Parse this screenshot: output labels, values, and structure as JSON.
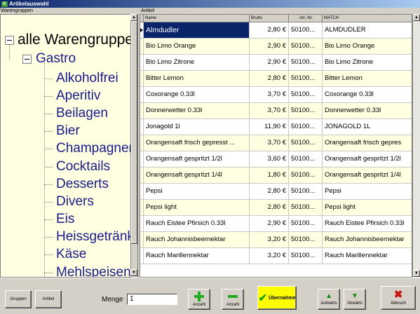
{
  "window": {
    "title": "Artikelauswahl",
    "app_icon_text": "K"
  },
  "left_panel": {
    "label": "Warengruppen",
    "root": "alle Warengruppen",
    "group": "Gastro",
    "children": [
      "Alkoholfrei",
      "Aperitiv",
      "Beilagen",
      "Bier",
      "Champagner",
      "Cocktails",
      "Desserts",
      "Divers",
      "Eis",
      "Heissgetränke",
      "Käse",
      "Mehlspeisen"
    ]
  },
  "grid": {
    "label": "Artikel",
    "columns": [
      "Name",
      "Brutto",
      "Art.-Nr.",
      "MATCH"
    ],
    "rows": [
      {
        "name": "Almdudler",
        "price": "2,80 €",
        "art": "50100...",
        "match": "ALMDUDLER"
      },
      {
        "name": "Bio Limo Orange",
        "price": "2,90 €",
        "art": "50100...",
        "match": "Bio Limo Orange"
      },
      {
        "name": "Bio Limo Zitrone",
        "price": "2,90 €",
        "art": "50100...",
        "match": "Bio Limo Zitrone"
      },
      {
        "name": "Bitter Lemon",
        "price": "2,80 €",
        "art": "50100...",
        "match": "Bitter Lemon"
      },
      {
        "name": "Coxorange 0.33l",
        "price": "3,70 €",
        "art": "50100...",
        "match": "Coxorange 0.33l"
      },
      {
        "name": "Donnerwetter 0.33l",
        "price": "3,70 €",
        "art": "50100...",
        "match": "Donnerwetter 0.33l"
      },
      {
        "name": "Jonagold 1l",
        "price": "11,90 €",
        "art": "50100...",
        "match": "JONAGOLD 1L"
      },
      {
        "name": "Orangensaft frisch gepresst ...",
        "price": "3,70 €",
        "art": "50100...",
        "match": "Orangensaft frisch gepres"
      },
      {
        "name": "Orangensaft gespritzt 1/2l",
        "price": "3,60 €",
        "art": "50100...",
        "match": "Orangensaft gespritzt 1/2l"
      },
      {
        "name": "Orangensaft gespritzt 1/4l",
        "price": "1,80 €",
        "art": "50100...",
        "match": "Orangensaft gespritzt 1/4l"
      },
      {
        "name": "Pepsi",
        "price": "2,80 €",
        "art": "50100...",
        "match": "Pepsi"
      },
      {
        "name": "Pepsi light",
        "price": "2,80 €",
        "art": "50100...",
        "match": "Pepsi light"
      },
      {
        "name": "Rauch Eistee Pfirsich 0.33l",
        "price": "2,90 €",
        "art": "50100...",
        "match": "Rauch Eistee Pfirsich 0.33l"
      },
      {
        "name": "Rauch Johannisbeernektar",
        "price": "3,20 €",
        "art": "50100...",
        "match": "Rauch Johannisbeernektar"
      },
      {
        "name": "Rauch Marillennektar",
        "price": "3,20 €",
        "art": "50100...",
        "match": "Rauch Marillennektar"
      }
    ]
  },
  "toolbar": {
    "gruppen": "Gruppen",
    "artikel": "Artikel",
    "menge_label": "Menge",
    "menge_value": "1",
    "plus": "Anzahl",
    "minus": "Anzahl",
    "uebernahme": "Übernahme",
    "aufwaerts": "Aufwärts",
    "abwaerts": "Abwärts",
    "abbruch": "Abbruch"
  },
  "colors": {
    "title_bar": "#0a246a",
    "row_highlight": "#ffffe1",
    "selection": "#0a246a",
    "tree_text": "#1a1a8a",
    "uebernahme_bg": "#ffff00"
  }
}
